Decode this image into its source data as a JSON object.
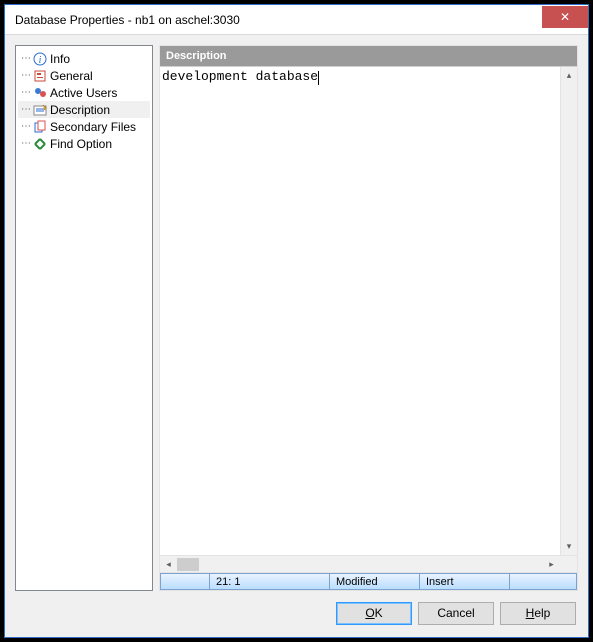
{
  "window": {
    "title": "Database Properties - nb1 on aschel:3030"
  },
  "nav": {
    "items": [
      {
        "label": "Info",
        "icon": "info-icon",
        "selected": false
      },
      {
        "label": "General",
        "icon": "general-icon",
        "selected": false
      },
      {
        "label": "Active Users",
        "icon": "users-icon",
        "selected": false
      },
      {
        "label": "Description",
        "icon": "desc-icon",
        "selected": true
      },
      {
        "label": "Secondary Files",
        "icon": "files-icon",
        "selected": false
      },
      {
        "label": "Find Option",
        "icon": "find-icon",
        "selected": false
      }
    ]
  },
  "content": {
    "header": "Description",
    "editor_text": "development database"
  },
  "status": {
    "position": "21:   1",
    "modified": "Modified",
    "mode": "Insert"
  },
  "buttons": {
    "ok": "OK",
    "cancel": "Cancel",
    "help": "Help"
  }
}
